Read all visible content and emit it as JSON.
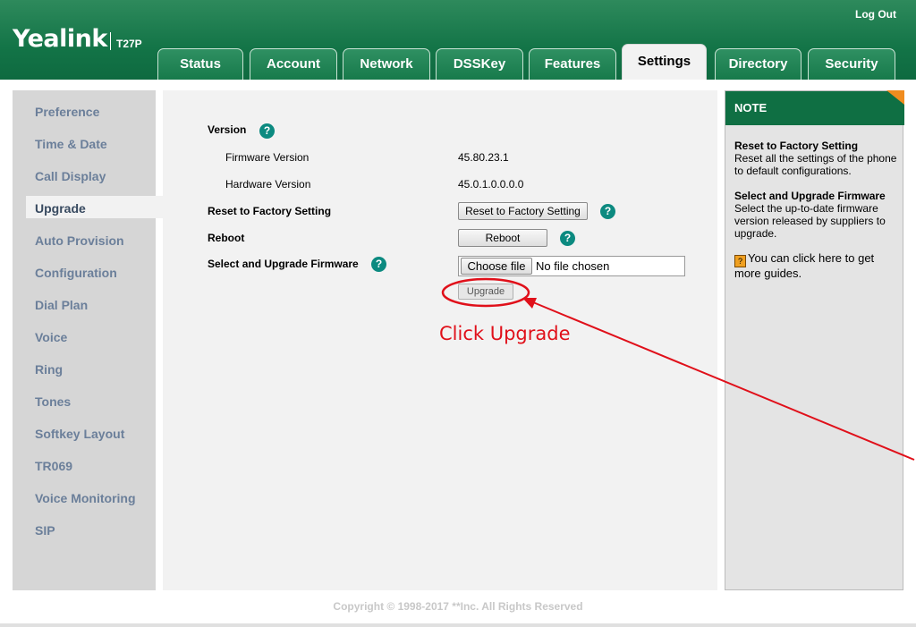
{
  "header": {
    "brand": "Yealink",
    "model": "T27P",
    "logout": "Log Out"
  },
  "tabs": [
    {
      "label": "Status",
      "active": false
    },
    {
      "label": "Account",
      "active": false
    },
    {
      "label": "Network",
      "active": false
    },
    {
      "label": "DSSKey",
      "active": false
    },
    {
      "label": "Features",
      "active": false
    },
    {
      "label": "Settings",
      "active": true
    },
    {
      "label": "Directory",
      "active": false
    },
    {
      "label": "Security",
      "active": false
    }
  ],
  "sidebar": {
    "items": [
      {
        "label": "Preference"
      },
      {
        "label": "Time & Date"
      },
      {
        "label": "Call Display"
      },
      {
        "label": "Upgrade",
        "active": true
      },
      {
        "label": "Auto Provision"
      },
      {
        "label": "Configuration"
      },
      {
        "label": "Dial Plan"
      },
      {
        "label": "Voice"
      },
      {
        "label": "Ring"
      },
      {
        "label": "Tones"
      },
      {
        "label": "Softkey Layout"
      },
      {
        "label": "TR069"
      },
      {
        "label": "Voice Monitoring"
      },
      {
        "label": "SIP"
      }
    ]
  },
  "main": {
    "version_label": "Version",
    "firmware_label": "Firmware Version",
    "firmware_value": "45.80.23.1",
    "hardware_label": "Hardware Version",
    "hardware_value": "45.0.1.0.0.0.0",
    "reset_label": "Reset to Factory Setting",
    "reset_button": "Reset to Factory Setting",
    "reboot_label": "Reboot",
    "reboot_button": "Reboot",
    "firmware_upgrade_label": "Select and Upgrade Firmware",
    "choose_file_button": "Choose file",
    "file_status": "No file chosen",
    "upgrade_button": "Upgrade",
    "help_glyph": "?"
  },
  "note": {
    "title": "NOTE",
    "sections": [
      {
        "heading": "Reset to Factory Setting",
        "text": "Reset all the settings of the phone to default configurations."
      },
      {
        "heading": "Select and Upgrade Firmware",
        "text": "Select the up-to-date firmware version released by suppliers to upgrade."
      }
    ],
    "guide_text": "You can click here to get more guides."
  },
  "footer": {
    "copyright": "Copyright © 1998-2017 **Inc. All Rights Reserved"
  },
  "annotation": {
    "text": "Click Upgrade",
    "color": "#e0101a"
  },
  "colors": {
    "header_green": "#137447",
    "help_teal": "#0c8a80",
    "note_corner": "#f08c1f"
  }
}
